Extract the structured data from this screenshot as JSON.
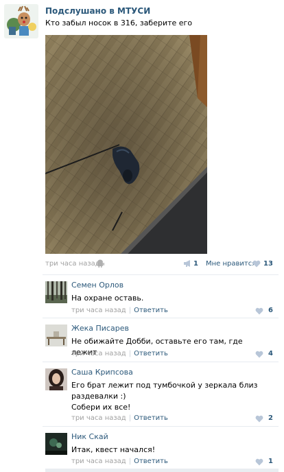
{
  "post": {
    "group_name": "Подслушано в МТУСИ",
    "text": "Кто забыл носок в 316, заберите его",
    "time": "три часа назад",
    "share_count": "1",
    "like_label": "Мне нравится",
    "like_count": "13"
  },
  "comments": [
    {
      "author": "Семен Орлов",
      "text_lines": [
        "На охране оставь."
      ],
      "time": "три часа назад",
      "reply_label": "Ответить",
      "likes": "6"
    },
    {
      "author": "Жека Писарев",
      "text_lines": [
        "Не обижайте Добби, оставьте его там, где лежит"
      ],
      "time": "три часа назад",
      "reply_label": "Ответить",
      "likes": "4"
    },
    {
      "author": "Саша Крипсова",
      "text_lines": [
        "Его брат лежит под тумбочкой у зеркала близ",
        "раздевалки :)",
        "Собери их все!"
      ],
      "time": "три часа назад",
      "reply_label": "Ответить",
      "likes": "2"
    },
    {
      "author": "Ник Скай",
      "text_lines": [
        "Итак, квест начался!"
      ],
      "time": "три часа назад",
      "reply_label": "Ответить",
      "likes": "1"
    }
  ],
  "icons": {
    "android": "android-icon",
    "share": "megaphone-icon",
    "like": "heart-icon"
  },
  "colors": {
    "link": "#2b587a",
    "muted": "#a0a0a0",
    "heart": "#b8c6d8"
  }
}
